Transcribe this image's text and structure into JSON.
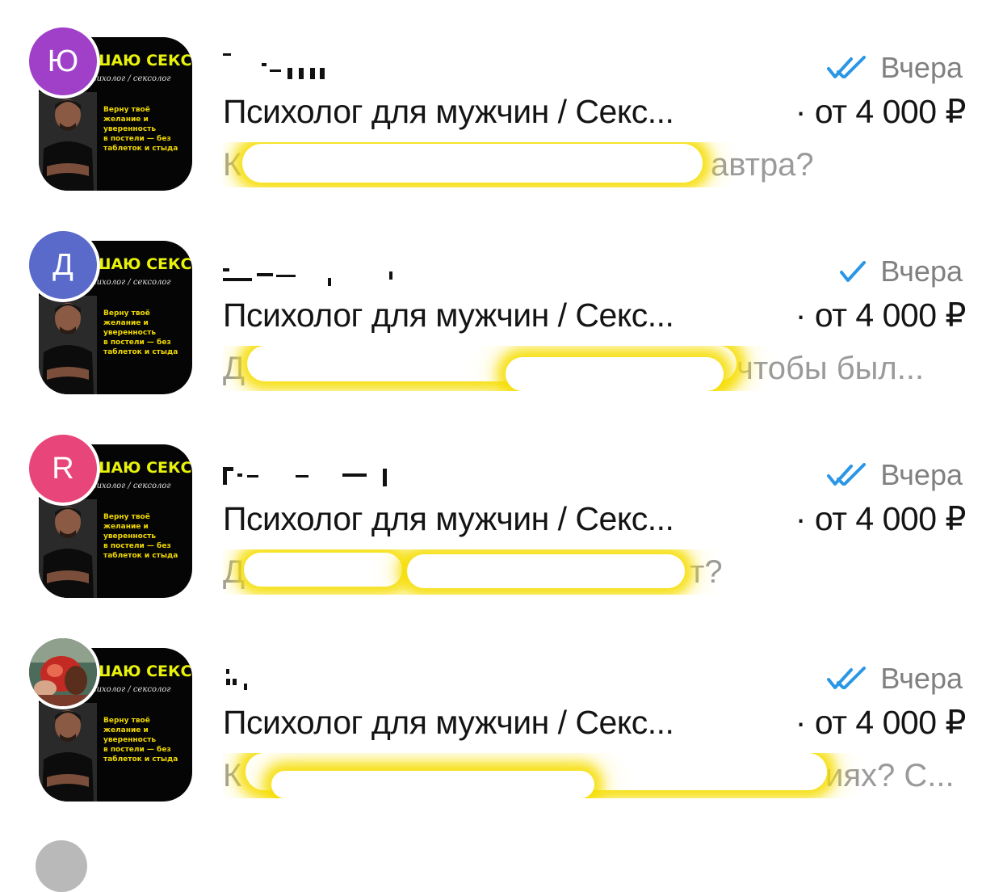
{
  "chats": [
    {
      "avatar_letter": "Ю",
      "avatar_color": "#a040c8",
      "time": "Вчера",
      "status": "read",
      "listing_title": "Психолог для мужчин / Секс...",
      "price": "· от 4 000 ₽",
      "preview_start": "К",
      "preview_end": "автра?"
    },
    {
      "avatar_letter": "Д",
      "avatar_color": "#5a6acb",
      "time": "Вчера",
      "status": "sent",
      "listing_title": "Психолог для мужчин / Секс...",
      "price": "· от 4 000 ₽",
      "preview_start": "Д",
      "preview_end": "чтобы был..."
    },
    {
      "avatar_letter": "R",
      "avatar_color": "#e8457a",
      "time": "Вчера",
      "status": "read",
      "listing_title": "Психолог для мужчин / Секс...",
      "price": "· от 4 000 ₽",
      "preview_start": "Д",
      "preview_end": "т?"
    },
    {
      "avatar_letter": "",
      "avatar_color": "#6b3a2a",
      "time": "Вчера",
      "status": "read",
      "listing_title": "Психолог для мужчин / Секс...",
      "price": "· от 4 000 ₽",
      "preview_start": "К",
      "preview_end": "иях? С..."
    }
  ],
  "thumbnail": {
    "title": "ШАЮ СЕКС",
    "subtitle": "сихолог / сексолог",
    "text": "Верну твоё\nжелание и\nуверенность\nв постели — без\nтаблеток и стыда"
  },
  "colors": {
    "check_blue": "#2a96e6",
    "highlight_yellow": "#f5dc00",
    "secondary_text": "#808080"
  }
}
